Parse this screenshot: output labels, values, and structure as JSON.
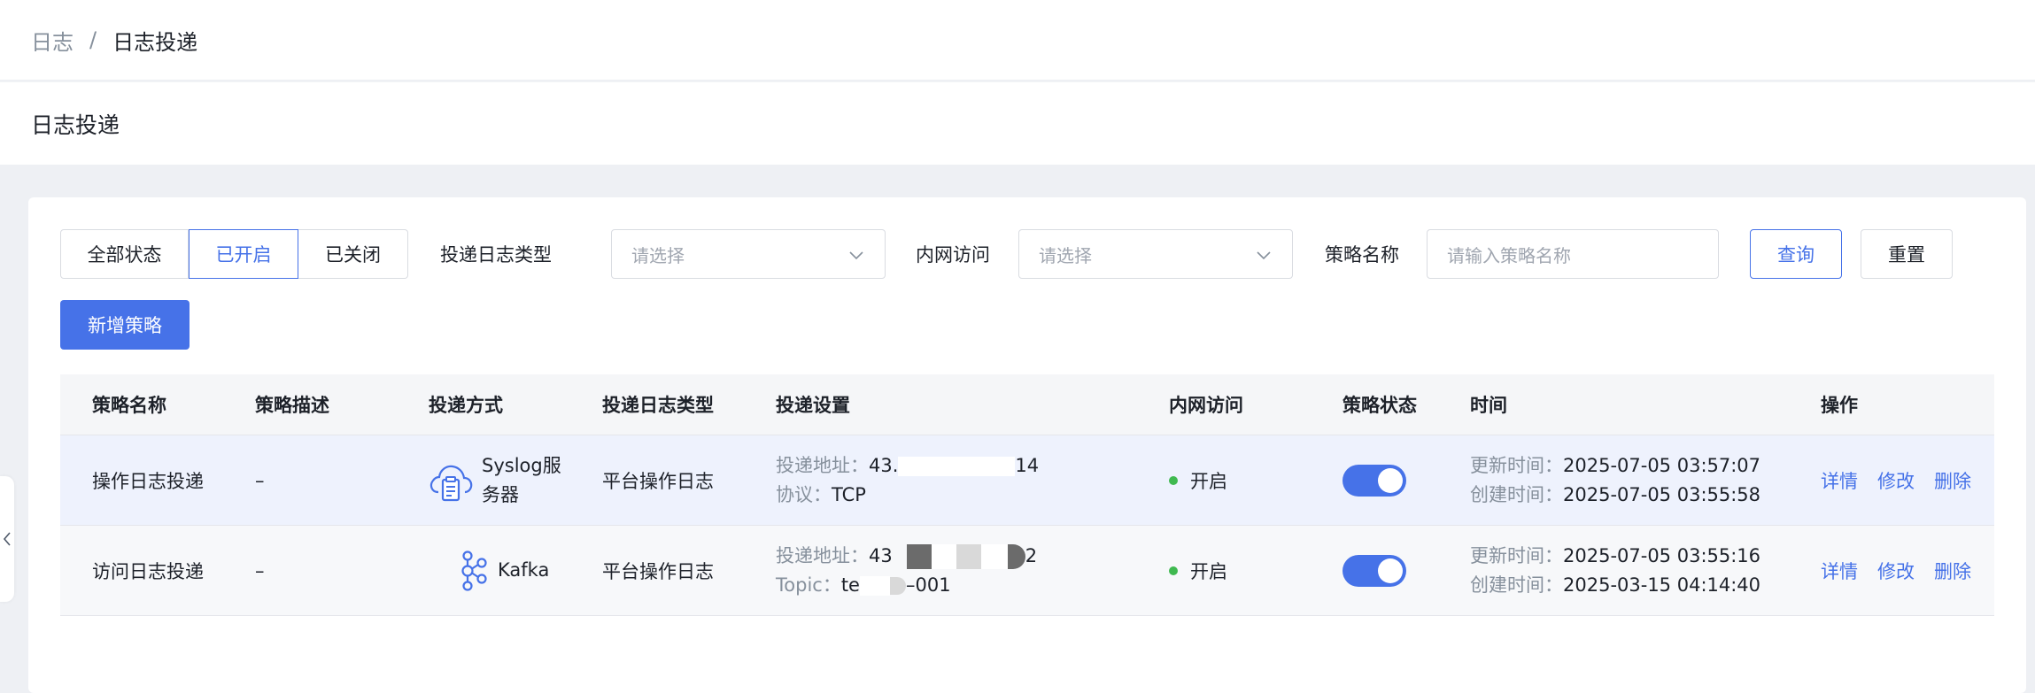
{
  "breadcrumb": {
    "parent": "日志",
    "separator": "/",
    "current": "日志投递"
  },
  "page_title": "日志投递",
  "filters": {
    "status_tabs": [
      "全部状态",
      "已开启",
      "已关闭"
    ],
    "log_type_label": "投递日志类型",
    "log_type_placeholder": "请选择",
    "intranet_label": "内网访问",
    "intranet_placeholder": "请选择",
    "policy_name_label": "策略名称",
    "policy_name_placeholder": "请输入策略名称",
    "query_label": "查询",
    "reset_label": "重置"
  },
  "add_button": "新增策略",
  "table": {
    "columns": [
      "策略名称",
      "策略描述",
      "投递方式",
      "投递日志类型",
      "投递设置",
      "内网访问",
      "策略状态",
      "时间",
      "操作"
    ],
    "rows": [
      {
        "name": "操作日志投递",
        "desc": "–",
        "method_icon": "cloud-clipboard-icon",
        "method_line1": "Syslog服",
        "method_line2": "务器",
        "log_type": "平台操作日志",
        "addr_label": "投递地址：",
        "addr_prefix": "43.",
        "addr_suffix": "14",
        "second_label": "协议：",
        "second_value": "TCP",
        "intranet": "开启",
        "enabled": true,
        "updated_label": "更新时间：",
        "updated": "2025-07-05 03:57:07",
        "created_label": "创建时间：",
        "created": "2025-07-05 03:55:58",
        "actions": [
          "详情",
          "修改",
          "删除"
        ]
      },
      {
        "name": "访问日志投递",
        "desc": "–",
        "method_icon": "kafka-icon",
        "method_line1": "Kafka",
        "log_type": "平台操作日志",
        "addr_label": "投递地址：",
        "addr_prefix": "43",
        "addr_suffix": "2",
        "second_label": "Topic：",
        "second_value_prefix": "te",
        "second_value_suffix": "–001",
        "intranet": "开启",
        "enabled": true,
        "updated_label": "更新时间：",
        "updated": "2025-07-05 03:55:16",
        "created_label": "创建时间：",
        "created": "2025-03-15 04:14:40",
        "actions": [
          "详情",
          "修改",
          "删除"
        ]
      }
    ]
  },
  "colors": {
    "primary": "#4672e8",
    "status_dot": "#3fb950",
    "page_bg": "#eef0f4"
  }
}
